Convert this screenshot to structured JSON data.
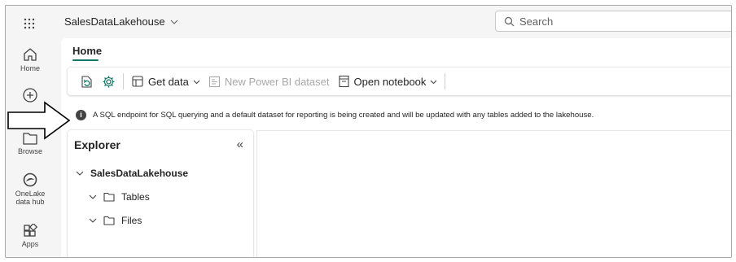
{
  "rail": {
    "items": [
      {
        "label": "Home"
      },
      {
        "label": "Create"
      },
      {
        "label": "Browse"
      },
      {
        "label": "OneLake data hub"
      },
      {
        "label": "Apps"
      }
    ]
  },
  "topbar": {
    "workspace_title": "SalesDataLakehouse",
    "search_placeholder": "Search"
  },
  "tabs": {
    "home": "Home"
  },
  "toolbar": {
    "get_data": "Get data",
    "new_dataset": "New Power BI dataset",
    "open_notebook": "Open notebook"
  },
  "info": {
    "message": "A SQL endpoint for SQL querying and a default dataset for reporting is being created and will be updated with any tables added to the lakehouse."
  },
  "explorer": {
    "title": "Explorer",
    "root": "SalesDataLakehouse",
    "children": [
      "Tables",
      "Files"
    ]
  },
  "colors": {
    "accent": "#117865",
    "icon_green": "#117865"
  }
}
